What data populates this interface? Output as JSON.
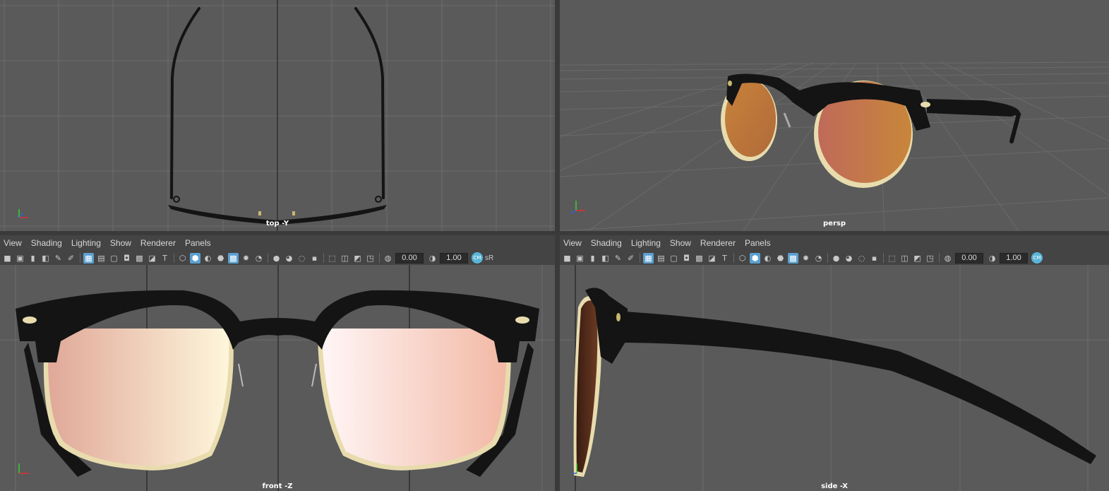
{
  "viewports": {
    "top": {
      "camera": "top -Y"
    },
    "persp": {
      "camera": "persp"
    },
    "front": {
      "camera": "front -Z"
    },
    "side": {
      "camera": "side -X"
    }
  },
  "panel_menu": [
    "View",
    "Shading",
    "Lighting",
    "Show",
    "Renderer",
    "Panels"
  ],
  "toolbar": {
    "exposure": "0.00",
    "gamma": "1.00",
    "color_space_badge": "CM",
    "color_space_text": "sR"
  },
  "colors": {
    "viewport_bg": "#5a5a5a",
    "grid": "#6c6c6c",
    "grid_axis": "#2e2e2e",
    "active_icon": "#5aa0d0",
    "frame": "#141414",
    "rim": "#e8dcae",
    "lens_front_a": "#e0a898",
    "lens_front_b": "#fcecd8",
    "lens_persp_a": "#c06a5a",
    "lens_persp_b": "#c8863a"
  }
}
